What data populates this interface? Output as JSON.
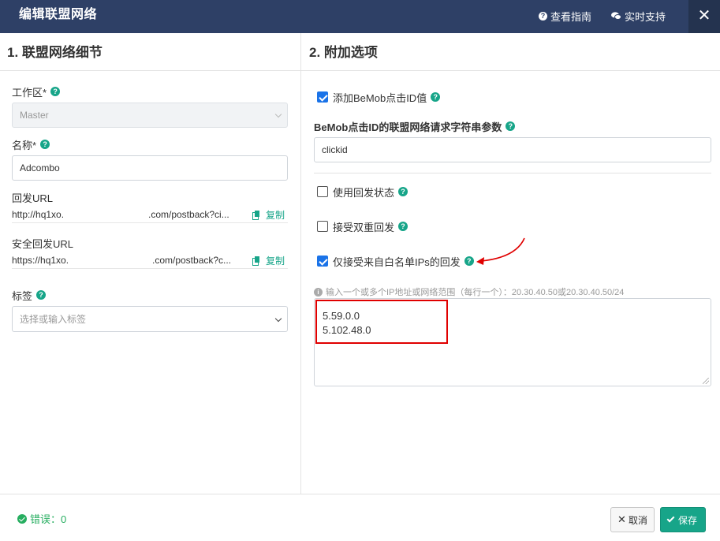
{
  "header": {
    "title": "编辑联盟网络",
    "guide_label": "查看指南",
    "support_label": "实时支持",
    "close_glyph": "✕"
  },
  "left": {
    "section_title": "1. 联盟网络细节",
    "workspace": {
      "label": "工作区*",
      "value": "Master"
    },
    "name": {
      "label": "名称*",
      "value": "Adcombo"
    },
    "postback_url": {
      "label": "回发URL",
      "part1": "http://hq1xo.",
      "part2": ".com/postback?ci...",
      "copy_label": "复制"
    },
    "secure_postback_url": {
      "label": "安全回发URL",
      "part1": "https://hq1xo.",
      "part2": ".com/postback?c...",
      "copy_label": "复制"
    },
    "tags": {
      "label": "标签",
      "placeholder": "选择或输入标签"
    }
  },
  "right": {
    "section_title": "2. 附加选项",
    "add_clickid": {
      "label": "添加BeMob点击ID值",
      "checked": true
    },
    "clickid_param": {
      "label": "BeMob点击ID的联盟网络请求字符串参数",
      "value": "clickid"
    },
    "use_postback_status": {
      "label": "使用回发状态",
      "checked": false
    },
    "accept_double_postback": {
      "label": "接受双重回发",
      "checked": false
    },
    "whitelist_only": {
      "label": "仅接受来自白名单IPs的回发",
      "checked": true
    },
    "ip_hint": "输入一个或多个IP地址或网络范围（每行一个）：20.30.40.50或20.30.40.50/24",
    "ip_list": [
      "5.59.0.0",
      "5.102.48.0"
    ]
  },
  "footer": {
    "errors_label": "错误：0",
    "cancel_label": "取消",
    "save_label": "保存"
  },
  "colors": {
    "header": "#2e4066",
    "accent": "#17a589",
    "checkbox": "#1a73e8",
    "highlight": "#e00000"
  }
}
